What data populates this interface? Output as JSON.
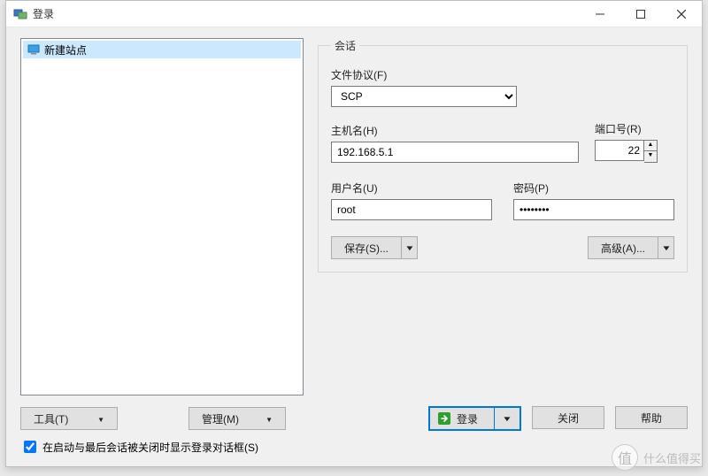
{
  "window": {
    "title": "登录"
  },
  "sites": {
    "items": [
      {
        "label": "新建站点"
      }
    ]
  },
  "session": {
    "legend": "会话",
    "protocol_label": "文件协议(F)",
    "protocol_value": "SCP",
    "host_label": "主机名(H)",
    "host_value": "192.168.5.1",
    "port_label": "端口号(R)",
    "port_value": "22",
    "user_label": "用户名(U)",
    "user_value": "root",
    "pass_label": "密码(P)",
    "pass_value": "••••••••",
    "save_label": "保存(S)...",
    "advanced_label": "高级(A)..."
  },
  "tools": {
    "tools_label": "工具(T)",
    "manage_label": "管理(M)"
  },
  "actions": {
    "login_label": "登录",
    "close_label": "关闭",
    "help_label": "帮助"
  },
  "checkbox": {
    "label": "在启动与最后会话被关闭时显示登录对话框(S)",
    "checked": true
  },
  "watermark": {
    "text": "什么值得买"
  }
}
